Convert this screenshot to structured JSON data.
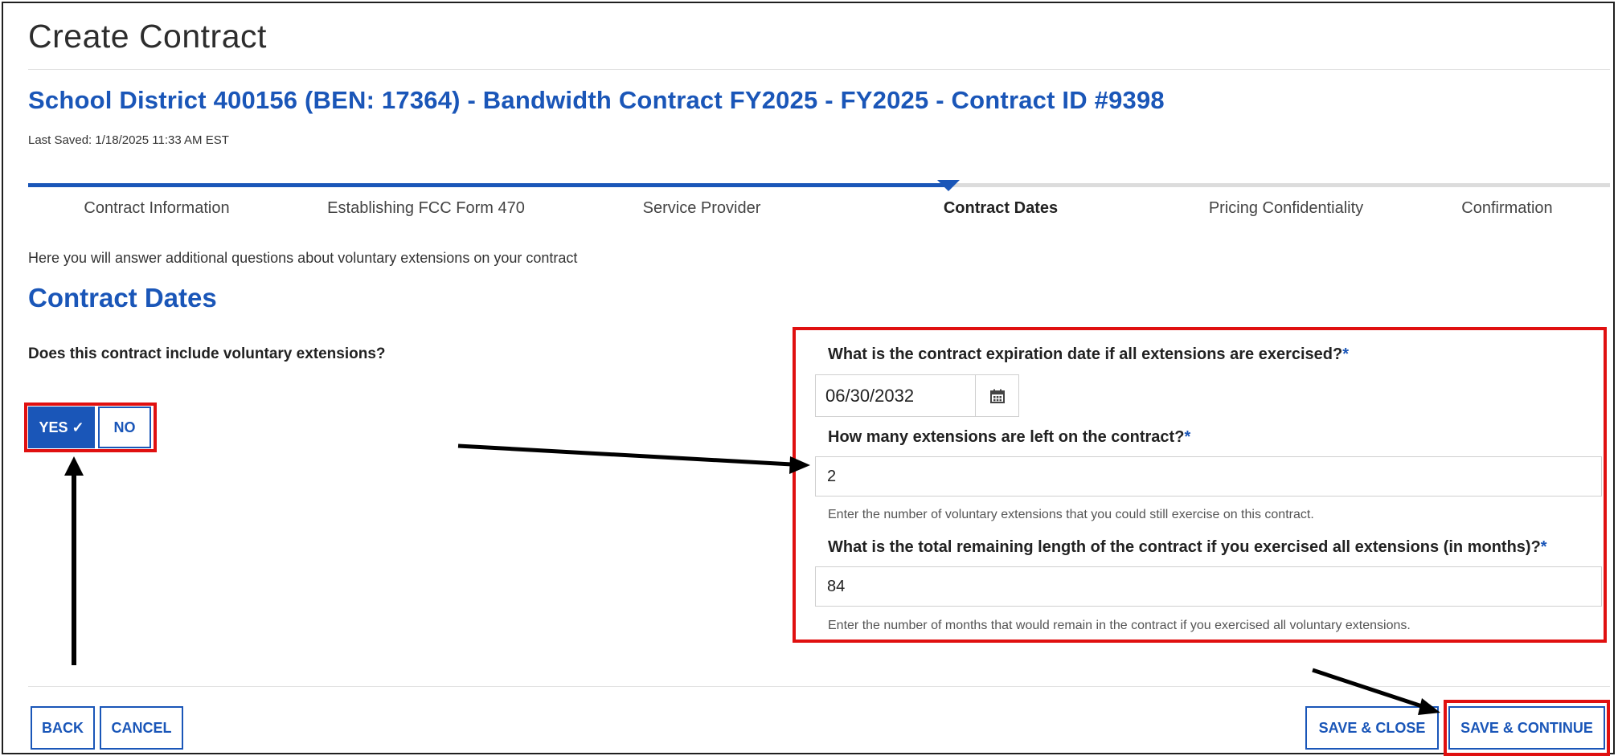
{
  "page_title": "Create Contract",
  "contract_heading": "School District 400156 (BEN: 17364) - Bandwidth Contract FY2025 - FY2025 - Contract ID #9398",
  "last_saved": "Last Saved: 1/18/2025 11:33 AM EST",
  "steps": [
    {
      "label": "Contract Information",
      "state": "completed"
    },
    {
      "label": "Establishing FCC Form 470",
      "state": "completed"
    },
    {
      "label": "Service Provider",
      "state": "completed"
    },
    {
      "label": "Contract Dates",
      "state": "active"
    },
    {
      "label": "Pricing Confidentiality",
      "state": "pending"
    },
    {
      "label": "Confirmation",
      "state": "pending"
    }
  ],
  "intro": "Here you will answer additional questions about voluntary extensions on your contract",
  "section_title": "Contract Dates",
  "voluntary_question": "Does this contract include voluntary extensions?",
  "yes_label": "YES ✓",
  "no_label": "NO",
  "expiration": {
    "question": "What is the contract expiration date if all extensions are exercised?",
    "required_mark": "*",
    "value": "06/30/2032"
  },
  "extensions_left": {
    "question": "How many extensions are left on the contract?",
    "required_mark": "*",
    "value": "2",
    "help": "Enter the number of voluntary extensions that you could still exercise on this contract."
  },
  "remaining_length": {
    "question": "What is the total remaining length of the contract if you exercised all extensions (in months)?",
    "required_mark": "*",
    "value": "84",
    "help": "Enter the number of months that would remain in the contract if you exercised all voluntary extensions."
  },
  "footer": {
    "back": "BACK",
    "cancel": "CANCEL",
    "save_close": "SAVE & CLOSE",
    "save_continue": "SAVE & CONTINUE"
  },
  "colors": {
    "brand_blue": "#1a56b8",
    "highlight_red": "#e01010",
    "annotation_arrow": "#000000"
  }
}
